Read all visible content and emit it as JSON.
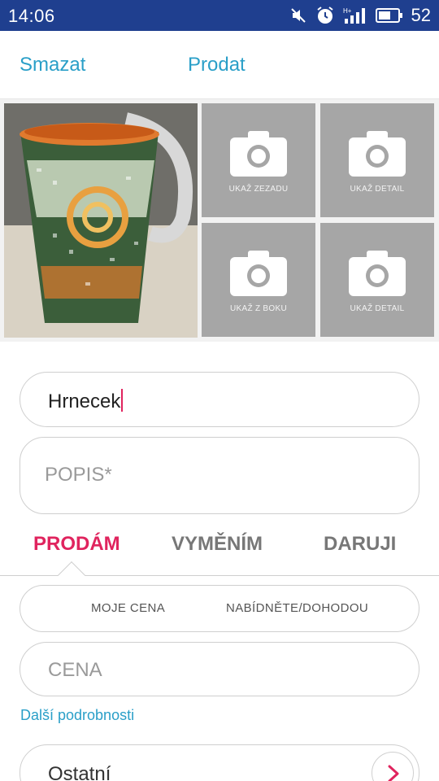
{
  "status_bar": {
    "time": "14:06",
    "battery": "52",
    "icons": [
      "muted-icon",
      "alarm-icon",
      "signal-icon",
      "battery-icon"
    ]
  },
  "action_bar": {
    "delete_label": "Smazat",
    "sell_label": "Prodat"
  },
  "photos": {
    "slots": [
      {
        "label": "UKAŽ ZEZADU",
        "icon": "camera-icon"
      },
      {
        "label": "UKAŽ DETAIL",
        "icon": "camera-icon"
      },
      {
        "label": "UKAŽ Z BOKU",
        "icon": "camera-icon"
      },
      {
        "label": "UKAŽ DETAIL",
        "icon": "camera-icon"
      }
    ]
  },
  "form": {
    "title_value": "Hrnecek",
    "description_placeholder": "POPIS*"
  },
  "tabs": {
    "sell": "PRODÁM",
    "swap": "VYMĚNÍM",
    "give": "DARUJI",
    "active": "sell"
  },
  "price_mode": {
    "my_price": "MOJE CENA",
    "offer": "NABÍDNĚTE/DOHODOU"
  },
  "price": {
    "placeholder": "CENA"
  },
  "more_details_label": "Další podrobnosti",
  "category": {
    "value": "Ostatní"
  },
  "colors": {
    "status_bar": "#1f3f8f",
    "link_blue": "#2a9fc8",
    "accent_pink": "#e0245e",
    "slot_gray": "#a6a6a6"
  }
}
